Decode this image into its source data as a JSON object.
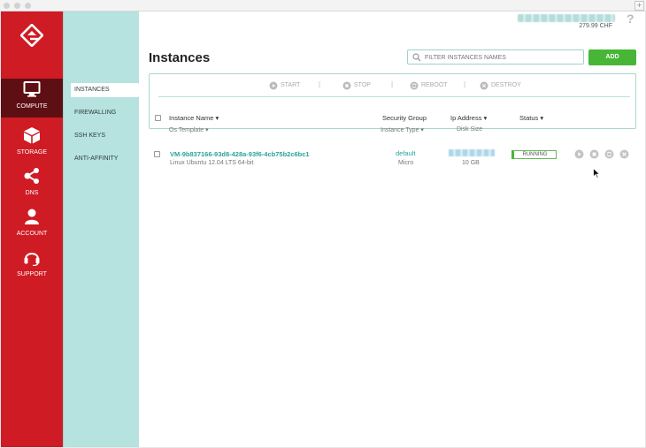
{
  "sidebar": {
    "items": [
      {
        "label": "COMPUTE",
        "icon": "monitor-icon"
      },
      {
        "label": "STORAGE",
        "icon": "cube-icon"
      },
      {
        "label": "DNS",
        "icon": "network-icon"
      },
      {
        "label": "ACCOUNT",
        "icon": "user-icon"
      },
      {
        "label": "SUPPORT",
        "icon": "headset-icon"
      }
    ]
  },
  "subnav": {
    "items": [
      {
        "label": "INSTANCES"
      },
      {
        "label": "FIREWALLING"
      },
      {
        "label": "SSH KEYS"
      },
      {
        "label": "ANTI-AFFINITY"
      }
    ]
  },
  "account": {
    "balance": "279.99 CHF",
    "help": "?"
  },
  "page": {
    "title": "Instances",
    "filter_placeholder": "FILTER INSTANCES NAMES",
    "add_label": "ADD"
  },
  "actions": {
    "start": "START",
    "stop": "STOP",
    "reboot": "REBOOT",
    "destroy": "DESTROY",
    "separator": "|"
  },
  "table": {
    "headers": {
      "name": "Instance Name",
      "template": "Os Template",
      "security_group": "Security Group",
      "instance_type": "Instance Type",
      "ip": "Ip Address",
      "disk": "Disk Size",
      "status": "Status"
    },
    "rows": [
      {
        "name": "VM-9b837166-93d8-428a-93f6-4cb75b2c6bc1",
        "os": "Linux Ubuntu 12.04 LTS 64-bit",
        "security_group": "default",
        "type": "Micro",
        "disk": "10 GB",
        "status": "RUNNING"
      }
    ]
  },
  "colors": {
    "sidebar": "#cf1b24",
    "sidebar_active": "#5e0f13",
    "subnav": "#b6e2df",
    "accent": "#2aa39a",
    "add_button": "#47b636"
  }
}
